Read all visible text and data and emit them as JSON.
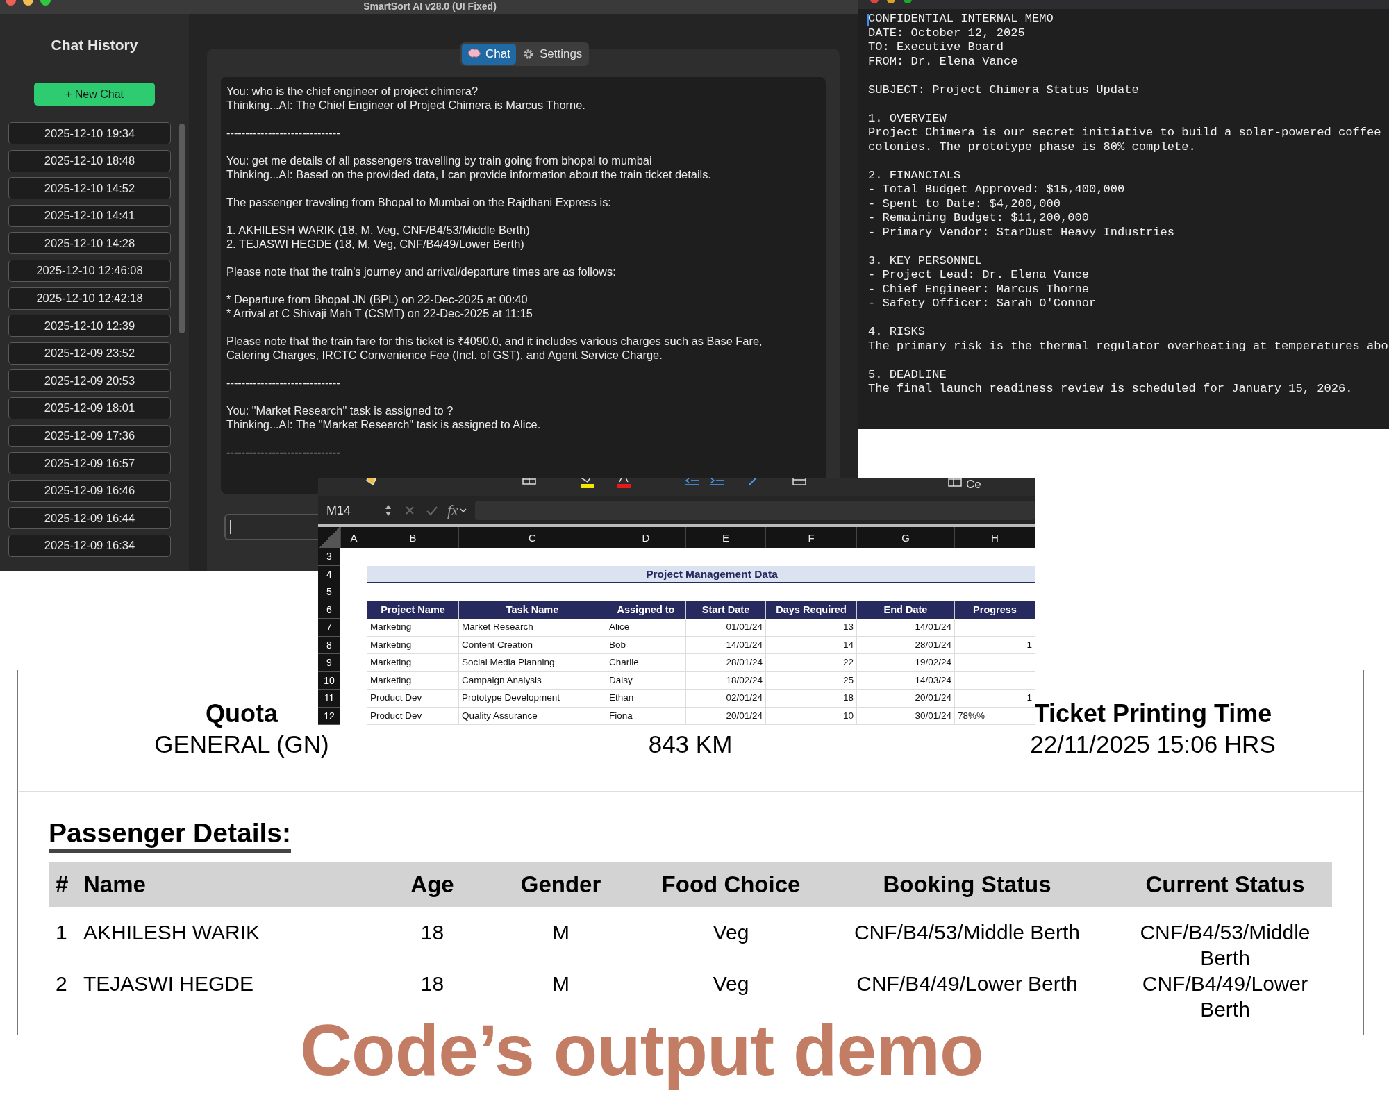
{
  "chat_app": {
    "window_title": "SmartSort AI v28.0 (UI Fixed)",
    "sidebar": {
      "title": "Chat History",
      "new_chat_button": "+ New Chat",
      "history": [
        {
          "label": "2025-12-10 19:34"
        },
        {
          "label": "2025-12-10 18:48"
        },
        {
          "label": "2025-12-10 14:52"
        },
        {
          "label": "2025-12-10 14:41"
        },
        {
          "label": "2025-12-10 14:28"
        },
        {
          "label": "2025-12-10 12:46:08"
        },
        {
          "label": "2025-12-10 12:42:18"
        },
        {
          "label": "2025-12-10 12:39"
        },
        {
          "label": "2025-12-09 23:52"
        },
        {
          "label": "2025-12-09 20:53"
        },
        {
          "label": "2025-12-09 18:01"
        },
        {
          "label": "2025-12-09 17:36"
        },
        {
          "label": "2025-12-09 16:57"
        },
        {
          "label": "2025-12-09 16:46"
        },
        {
          "label": "2025-12-09 16:44"
        },
        {
          "label": "2025-12-09 16:34"
        }
      ]
    },
    "tabs": [
      {
        "label": "Chat",
        "kind": "chat",
        "selected": true
      },
      {
        "label": "Settings",
        "kind": "settings",
        "selected": false
      }
    ],
    "conversation": [
      [
        "You: who is the chief engineer of project chimera?",
        "Thinking...AI: The Chief Engineer of Project Chimera is Marcus Thorne."
      ],
      [
        "------------------------------"
      ],
      [
        "You: get me details of all passengers travelling by train going from bhopal to mumbai",
        "Thinking...AI: Based on the provided data, I can provide information about the train ticket details."
      ],
      [
        "The passenger traveling from Bhopal to Mumbai on the Rajdhani Express is:"
      ],
      [
        "1. AKHILESH WARIK (18, M, Veg, CNF/B4/53/Middle Berth)",
        "2. TEJASWI HEGDE (18, M, Veg, CNF/B4/49/Lower Berth)"
      ],
      [
        "Please note that the train's journey and arrival/departure times are as follows:"
      ],
      [
        "* Departure from Bhopal JN (BPL) on 22-Dec-2025 at 00:40",
        "* Arrival at C Shivaji Mah T (CSMT) on 22-Dec-2025 at 11:15"
      ],
      [
        "Please note that the train fare for this ticket is ₹4090.0, and it includes various charges such as Base Fare,",
        "Catering Charges, IRCTC Convenience Fee (Incl. of GST), and Agent Service Charge."
      ],
      [
        "------------------------------"
      ],
      [
        "You: \"Market Research\" task is assigned to ?",
        "Thinking...AI: The \"Market Research\" task is assigned to Alice."
      ],
      [
        "------------------------------"
      ]
    ]
  },
  "memo_editor": {
    "paragraphs": [
      [
        "CONFIDENTIAL INTERNAL MEMO",
        "DATE: October 12, 2025",
        "TO: Executive Board",
        "FROM: Dr. Elena Vance"
      ],
      [
        "SUBJECT: Project Chimera Status Update"
      ],
      [
        "1. OVERVIEW",
        "Project Chimera is our secret initiative to build a solar-powered coffee",
        "colonies. The prototype phase is 80% complete."
      ],
      [
        "2. FINANCIALS",
        "- Total Budget Approved: $15,400,000",
        "- Spent to Date: $4,200,000",
        "- Remaining Budget: $11,200,000",
        "- Primary Vendor: StarDust Heavy Industries"
      ],
      [
        "3. KEY PERSONNEL",
        "- Project Lead: Dr. Elena Vance",
        "- Chief Engineer: Marcus Thorne",
        "- Safety Officer: Sarah O'Connor"
      ],
      [
        "4. RISKS",
        "The primary risk is the thermal regulator overheating at temperatures abo"
      ],
      [
        "5. DEADLINE",
        "The final launch readiness review is scheduled for January 15, 2026."
      ]
    ]
  },
  "spreadsheet": {
    "toolbar_label": "Ce",
    "name_box": "M14",
    "function_label": "fx",
    "column_letters": [
      "A",
      "B",
      "C",
      "D",
      "E",
      "F",
      "G",
      "H"
    ],
    "row_numbers": [
      "3",
      "4",
      "5",
      "6",
      "7",
      "8",
      "9",
      "10",
      "11",
      "12"
    ],
    "title": "Project Management Data",
    "headers": [
      "Project Name",
      "Task Name",
      "Assigned to",
      "Start Date",
      "Days Required",
      "End Date",
      "Progress"
    ],
    "rows": [
      {
        "cells": [
          "Marketing",
          "Market Research",
          "Alice",
          "01/01/24",
          "13",
          "14/01/24"
        ]
      },
      {
        "cells": [
          "Marketing",
          "Content Creation",
          "Bob",
          "14/01/24",
          "14",
          "28/01/24"
        ],
        "progress": {
          "text": "1",
          "kind": "number"
        }
      },
      {
        "cells": [
          "Marketing",
          "Social Media Planning",
          "Charlie",
          "28/01/24",
          "22",
          "19/02/24"
        ]
      },
      {
        "cells": [
          "Marketing",
          "Campaign Analysis",
          "Daisy",
          "18/02/24",
          "25",
          "14/03/24"
        ]
      },
      {
        "cells": [
          "Product Dev",
          "Prototype Development",
          "Ethan",
          "02/01/24",
          "18",
          "20/01/24"
        ],
        "progress": {
          "text": "1",
          "kind": "number"
        }
      },
      {
        "cells": [
          "Product Dev",
          "Quality Assurance",
          "Fiona",
          "20/01/24",
          "10",
          "30/01/24"
        ],
        "progress": {
          "text": "78%%",
          "kind": "text"
        }
      }
    ]
  },
  "ticket": {
    "quota_label": "Quota",
    "quota_value": "GENERAL (GN)",
    "distance_value": "843 KM",
    "print_time_label": "Ticket Printing Time",
    "print_time_value": "22/11/2025 15:06 HRS",
    "passenger_heading": "Passenger Details:",
    "columns": [
      "#",
      "Name",
      "Age",
      "Gender",
      "Food Choice",
      "Booking Status",
      "Current Status"
    ],
    "passengers": [
      [
        "1",
        "AKHILESH WARIK",
        "18",
        "M",
        "Veg",
        "CNF/B4/53/Middle Berth",
        "CNF/B4/53/Middle Berth"
      ],
      [
        "2",
        "TEJASWI HEGDE",
        "18",
        "M",
        "Veg",
        "CNF/B4/49/Lower Berth",
        "CNF/B4/49/Lower Berth"
      ]
    ]
  },
  "caption": "Code’s output demo"
}
